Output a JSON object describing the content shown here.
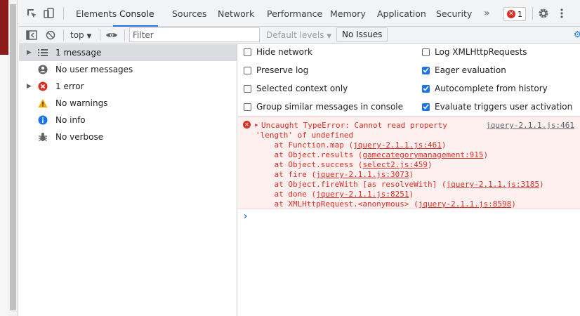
{
  "tabs": [
    {
      "label": "Elements"
    },
    {
      "label": "Console"
    },
    {
      "label": "Sources"
    },
    {
      "label": "Network"
    },
    {
      "label": "Performance"
    },
    {
      "label": "Memory"
    },
    {
      "label": "Application"
    },
    {
      "label": "Security"
    }
  ],
  "more_tabs": "»",
  "error_count": "1",
  "toolbar": {
    "context": "top",
    "filter_placeholder": "Filter",
    "levels": "Default levels",
    "no_issues": "No Issues"
  },
  "sidebar": [
    {
      "label": "1 message",
      "icon": "list-icon"
    },
    {
      "label": "No user messages",
      "icon": "user-icon"
    },
    {
      "label": "1 error",
      "icon": "error-icon"
    },
    {
      "label": "No warnings",
      "icon": "warning-icon"
    },
    {
      "label": "No info",
      "icon": "info-icon"
    },
    {
      "label": "No verbose",
      "icon": "bug-icon"
    }
  ],
  "options": [
    {
      "label": "Hide network",
      "checked": false
    },
    {
      "label": "Preserve log",
      "checked": false
    },
    {
      "label": "Selected context only",
      "checked": false
    },
    {
      "label": "Group similar messages in console",
      "checked": false
    },
    {
      "label": "Log XMLHttpRequests",
      "checked": false
    },
    {
      "label": "Eager evaluation",
      "checked": true
    },
    {
      "label": "Autocomplete from history",
      "checked": true
    },
    {
      "label": "Evaluate triggers user activation",
      "checked": true
    }
  ],
  "error": {
    "source": "jquery-2.1.1.js:461",
    "message": "Uncaught TypeError: Cannot read property",
    "message2": "'length' of undefined",
    "stack": [
      {
        "prefix": "    at Function.map (",
        "link": "jquery-2.1.1.js:461",
        "suffix": ")"
      },
      {
        "prefix": "    at Object.results (",
        "link": "gamecategorymanagement:915",
        "suffix": ")"
      },
      {
        "prefix": "    at Object.success (",
        "link": "select2.js:459",
        "suffix": ")"
      },
      {
        "prefix": "    at fire (",
        "link": "jquery-2.1.1.js:3073",
        "suffix": ")"
      },
      {
        "prefix": "    at Object.fireWith [as resolveWith] (",
        "link": "jquery-2.1.1.js:3185",
        "suffix": ")"
      },
      {
        "prefix": "    at done (",
        "link": "jquery-2.1.1.js:8251",
        "suffix": ")"
      },
      {
        "prefix": "    at XMLHttpRequest.<anonymous> (",
        "link": "jquery-2.1.1.js:8598",
        "suffix": ")"
      }
    ]
  },
  "prompt": "›",
  "colors": {
    "accent": "#1a73e8",
    "error": "#d93025",
    "error_bg": "#fff0f0",
    "warning": "#f9ab00"
  }
}
